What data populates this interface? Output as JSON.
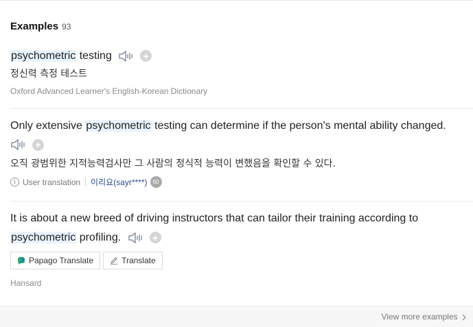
{
  "header": {
    "title": "Examples",
    "count": "93"
  },
  "examples": [
    {
      "before": "",
      "keyword": "psychometric",
      "after": " testing",
      "translation": "정신력 측정 테스트",
      "source": "Oxford Advanced Learner's English-Korean Dictionary"
    },
    {
      "before": "Only extensive ",
      "keyword": "psychometric",
      "after": " testing can determine if the person's mental ability changed.",
      "translation": "오직 광범위한 지적능력검사만 그 사람의 정식적 능력이 변했음을 확인할 수 있다.",
      "meta_label": "User translation",
      "user": "이리요(sayr****)",
      "badge": "60"
    },
    {
      "line1": "It is about a new breed of driving instructors that can tailor their training according to",
      "keyword": "psychometric",
      "after": " profiling.",
      "buttons": {
        "papago": "Papago Translate",
        "translate": "Translate"
      },
      "source": "Hansard"
    }
  ],
  "footer": {
    "more": "View more examples"
  },
  "icons": {
    "speaker": "speaker-icon",
    "add": "plus-icon",
    "info": "info-icon",
    "papago": "papago-logo-icon",
    "pen": "pen-icon",
    "chevron": "chevron-right-icon"
  }
}
